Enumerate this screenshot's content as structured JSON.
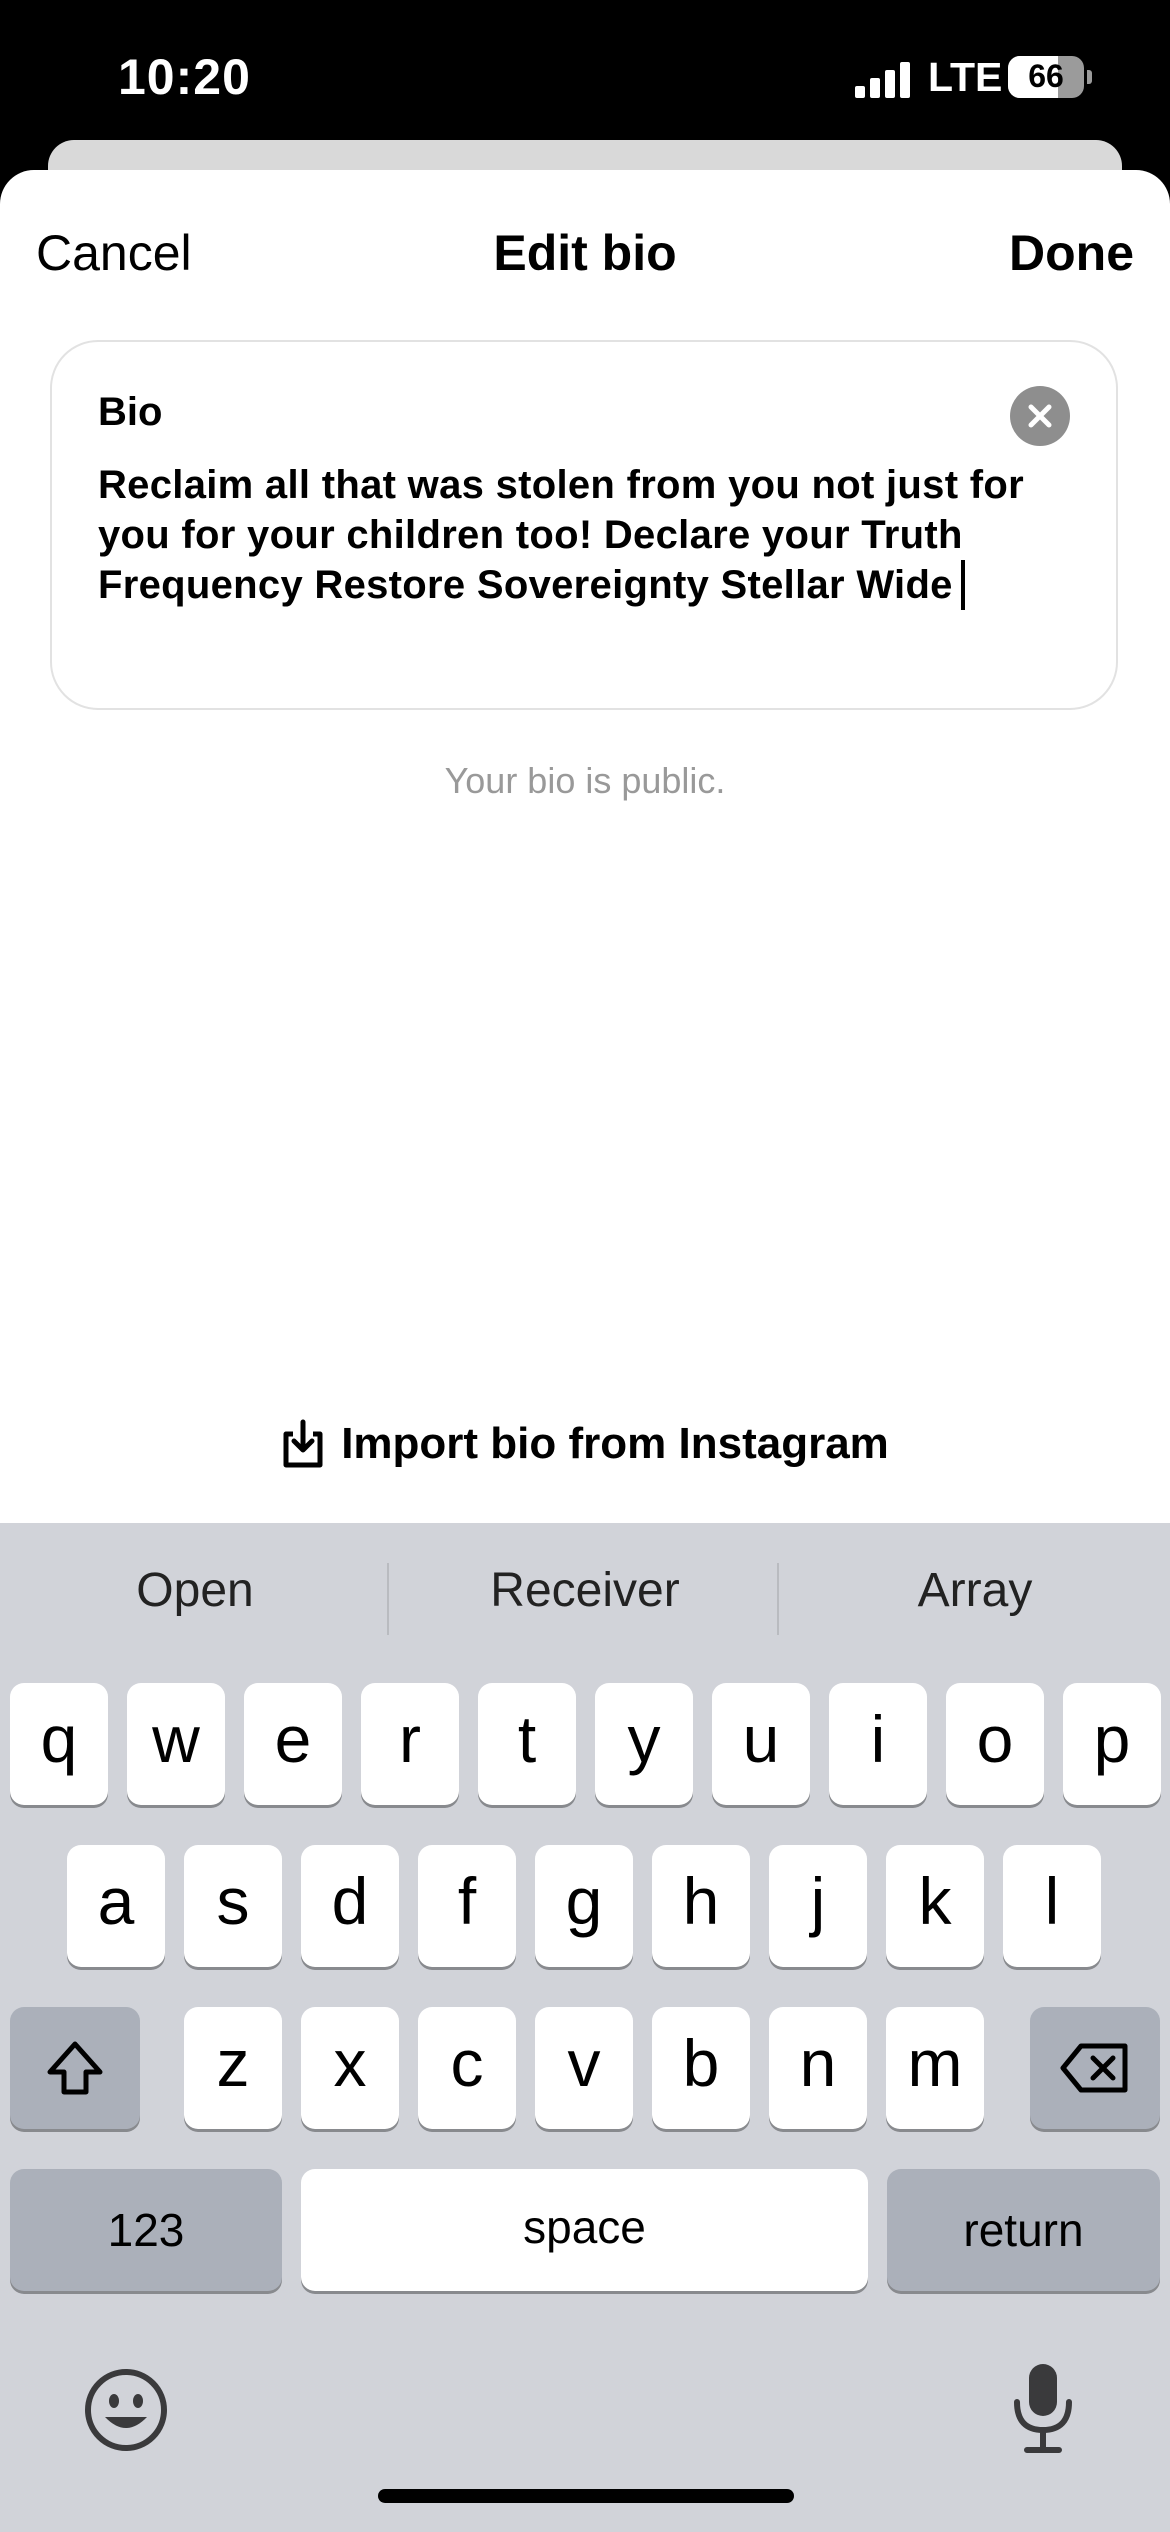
{
  "status_bar": {
    "time": "10:20",
    "network": "LTE",
    "battery": "66",
    "battery_level": 0.66
  },
  "nav": {
    "cancel": "Cancel",
    "title": "Edit bio",
    "done": "Done"
  },
  "bio": {
    "label": "Bio",
    "lines": [
      "Reclaim all that was stolen from you not just for",
      "you for your children too!  Declare your Truth",
      "Frequency Restore Sovereignty Stellar Wide"
    ]
  },
  "public_note": "Your bio is public.",
  "import_label": "Import bio from Instagram",
  "keyboard": {
    "suggestions": [
      "Open",
      "Receiver",
      "Array"
    ],
    "row1": [
      "q",
      "w",
      "e",
      "r",
      "t",
      "y",
      "u",
      "i",
      "o",
      "p"
    ],
    "row2": [
      "a",
      "s",
      "d",
      "f",
      "g",
      "h",
      "j",
      "k",
      "l"
    ],
    "row3": [
      "z",
      "x",
      "c",
      "v",
      "b",
      "n",
      "m"
    ],
    "numbers_key": "123",
    "space_key": "space",
    "return_key": "return"
  },
  "icons": {
    "close": "close-icon",
    "import": "import-icon",
    "shift": "shift-icon",
    "delete": "delete-icon",
    "emoji": "emoji-icon",
    "mic": "microphone-icon"
  }
}
